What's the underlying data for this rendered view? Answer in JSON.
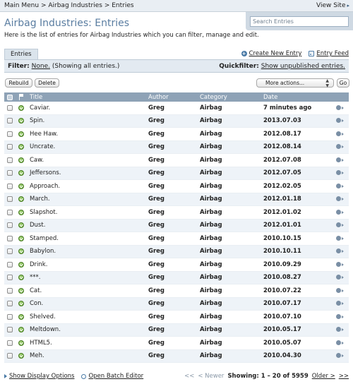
{
  "breadcrumb": {
    "main_menu": "Main Menu",
    "sep1": ">",
    "blog": "Airbag Industries",
    "sep2": ">",
    "current": "Entries"
  },
  "view_site": {
    "label": "View Site",
    "arrow": "▸"
  },
  "search": {
    "placeholder": "Search Entries"
  },
  "page": {
    "title": "Airbag Industries: Entries",
    "description": "Here is the list of entries for Airbag Industries which you can filter, manage and edit."
  },
  "tab": {
    "label": "Entries"
  },
  "actions": {
    "create": "Create New Entry",
    "feed": "Entry Feed"
  },
  "filter": {
    "label": "Filter:",
    "value": "None.",
    "note": "(Showing all entries.)",
    "quick_label": "Quickfilter:",
    "quick_value": "Show unpublished entries."
  },
  "buttons": {
    "rebuild": "Rebuild",
    "delete": "Delete",
    "more_actions": "More actions...",
    "go": "Go"
  },
  "table": {
    "columns": {
      "title": "Title",
      "author": "Author",
      "category": "Category",
      "date": "Date"
    },
    "rows": [
      {
        "title": "Caviar.",
        "author": "Greg",
        "category": "Airbag",
        "date": "7 minutes ago"
      },
      {
        "title": "Spin.",
        "author": "Greg",
        "category": "Airbag",
        "date": "2013.07.03"
      },
      {
        "title": "Hee Haw.",
        "author": "Greg",
        "category": "Airbag",
        "date": "2012.08.17"
      },
      {
        "title": "Uncrate.",
        "author": "Greg",
        "category": "Airbag",
        "date": "2012.08.14"
      },
      {
        "title": "Caw.",
        "author": "Greg",
        "category": "Airbag",
        "date": "2012.07.08"
      },
      {
        "title": "Jeffersons.",
        "author": "Greg",
        "category": "Airbag",
        "date": "2012.07.05"
      },
      {
        "title": "Approach.",
        "author": "Greg",
        "category": "Airbag",
        "date": "2012.02.05"
      },
      {
        "title": "March.",
        "author": "Greg",
        "category": "Airbag",
        "date": "2012.01.18"
      },
      {
        "title": "Slapshot.",
        "author": "Greg",
        "category": "Airbag",
        "date": "2012.01.02"
      },
      {
        "title": "Dust.",
        "author": "Greg",
        "category": "Airbag",
        "date": "2012.01.01"
      },
      {
        "title": "Stamped.",
        "author": "Greg",
        "category": "Airbag",
        "date": "2010.10.15"
      },
      {
        "title": "Babylon.",
        "author": "Greg",
        "category": "Airbag",
        "date": "2010.10.11"
      },
      {
        "title": "Drink.",
        "author": "Greg",
        "category": "Airbag",
        "date": "2010.09.29"
      },
      {
        "title": "***.",
        "author": "Greg",
        "category": "Airbag",
        "date": "2010.08.27"
      },
      {
        "title": "Cat.",
        "author": "Greg",
        "category": "Airbag",
        "date": "2010.07.22"
      },
      {
        "title": "Con.",
        "author": "Greg",
        "category": "Airbag",
        "date": "2010.07.17"
      },
      {
        "title": "Shelved.",
        "author": "Greg",
        "category": "Airbag",
        "date": "2010.07.10"
      },
      {
        "title": "Meltdown.",
        "author": "Greg",
        "category": "Airbag",
        "date": "2010.05.17"
      },
      {
        "title": "HTML5.",
        "author": "Greg",
        "category": "Airbag",
        "date": "2010.05.07"
      },
      {
        "title": "Meh.",
        "author": "Greg",
        "category": "Airbag",
        "date": "2010.04.30"
      }
    ]
  },
  "footer": {
    "display_options": "Show Display Options",
    "batch_editor": "Open Batch Editor",
    "first": "<<",
    "newer": "< Newer",
    "showing": "Showing: 1 – 20 of 5959",
    "older": "Older >",
    "last": ">>"
  }
}
